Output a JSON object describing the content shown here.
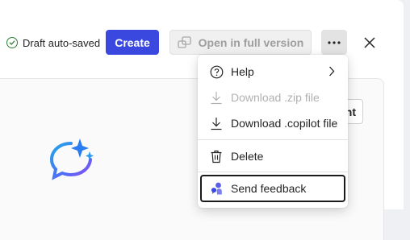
{
  "header": {
    "draft_status": "Draft auto-saved",
    "create_label": "Create",
    "open_full_label": "Open in full version",
    "more_icon": "ellipsis-icon",
    "close_icon": "close-icon"
  },
  "background": {
    "partial_button_label": "nt"
  },
  "menu": {
    "items": [
      {
        "label": "Help",
        "icon": "help-circle-icon",
        "submenu": true,
        "enabled": true
      },
      {
        "label": "Download .zip file",
        "icon": "download-icon",
        "enabled": false
      },
      {
        "label": "Download .copilot file",
        "icon": "download-icon",
        "enabled": true
      },
      {
        "label": "Delete",
        "icon": "trash-icon",
        "enabled": true
      },
      {
        "label": "Send feedback",
        "icon": "feedback-icon",
        "enabled": true,
        "focused": true
      }
    ]
  },
  "colors": {
    "accent": "#3b48e0",
    "success": "#2e7d32"
  }
}
